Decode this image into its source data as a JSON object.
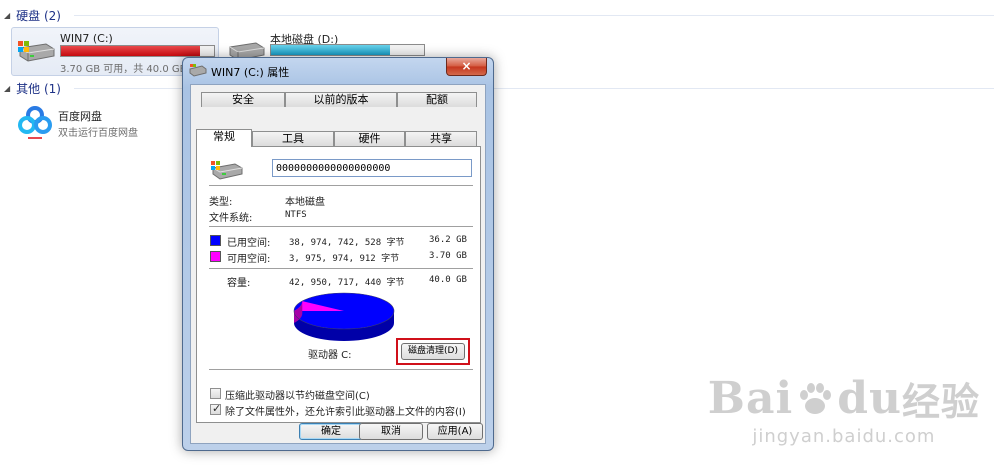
{
  "explorer": {
    "groups": {
      "disks": "硬盘 (2)",
      "other": "其他 (1)"
    },
    "drives": [
      {
        "name": "WIN7 (C:)",
        "subtitle": "3.70 GB 可用，共 40.0 GB",
        "used_fraction": 0.91,
        "bar_color": "#cc1016"
      },
      {
        "name": "本地磁盘 (D:)",
        "subtitle": "",
        "used_fraction": 0.78,
        "bar_color": "#22a3cb"
      }
    ],
    "apps": [
      {
        "name": "百度网盘",
        "subtitle": "双击运行百度网盘"
      }
    ]
  },
  "dialog": {
    "title": "WIN7 (C:) 属性",
    "close_label": "×",
    "tabs_back": [
      "安全",
      "以前的版本",
      "配额"
    ],
    "tabs_front": [
      "常规",
      "工具",
      "硬件",
      "共享"
    ],
    "active_tab": "常规",
    "volume_label_value": "0000000000000000000",
    "type_label": "类型:",
    "type_value": "本地磁盘",
    "fs_label": "文件系统:",
    "fs_value": "NTFS",
    "used_label": "已用空间:",
    "used_bytes": "38, 974, 742, 528 字节",
    "used_gb": "36.2 GB",
    "free_label": "可用空间:",
    "free_bytes": "3, 975, 974, 912 字节",
    "free_gb": "3.70 GB",
    "capacity_label": "容量:",
    "capacity_bytes": "42, 950, 717, 440 字节",
    "capacity_gb": "40.0 GB",
    "drive_caption": "驱动器 C:",
    "cleanup_button": "磁盘清理(D)",
    "compress_label": "压缩此驱动器以节约磁盘空间(C)",
    "compress_checked": false,
    "index_label": "除了文件属性外，还允许索引此驱动器上文件的内容(I)",
    "index_checked": true,
    "ok_button": "确定",
    "cancel_button": "取消",
    "apply_button": "应用(A)",
    "colors": {
      "used": "#0000ff",
      "free": "#ff00ff"
    },
    "used_fraction": 0.907
  },
  "watermark": {
    "logo_left": "Bai",
    "logo_right": "du",
    "logo_cn": "经验",
    "sub": "jingyan.baidu.com"
  }
}
